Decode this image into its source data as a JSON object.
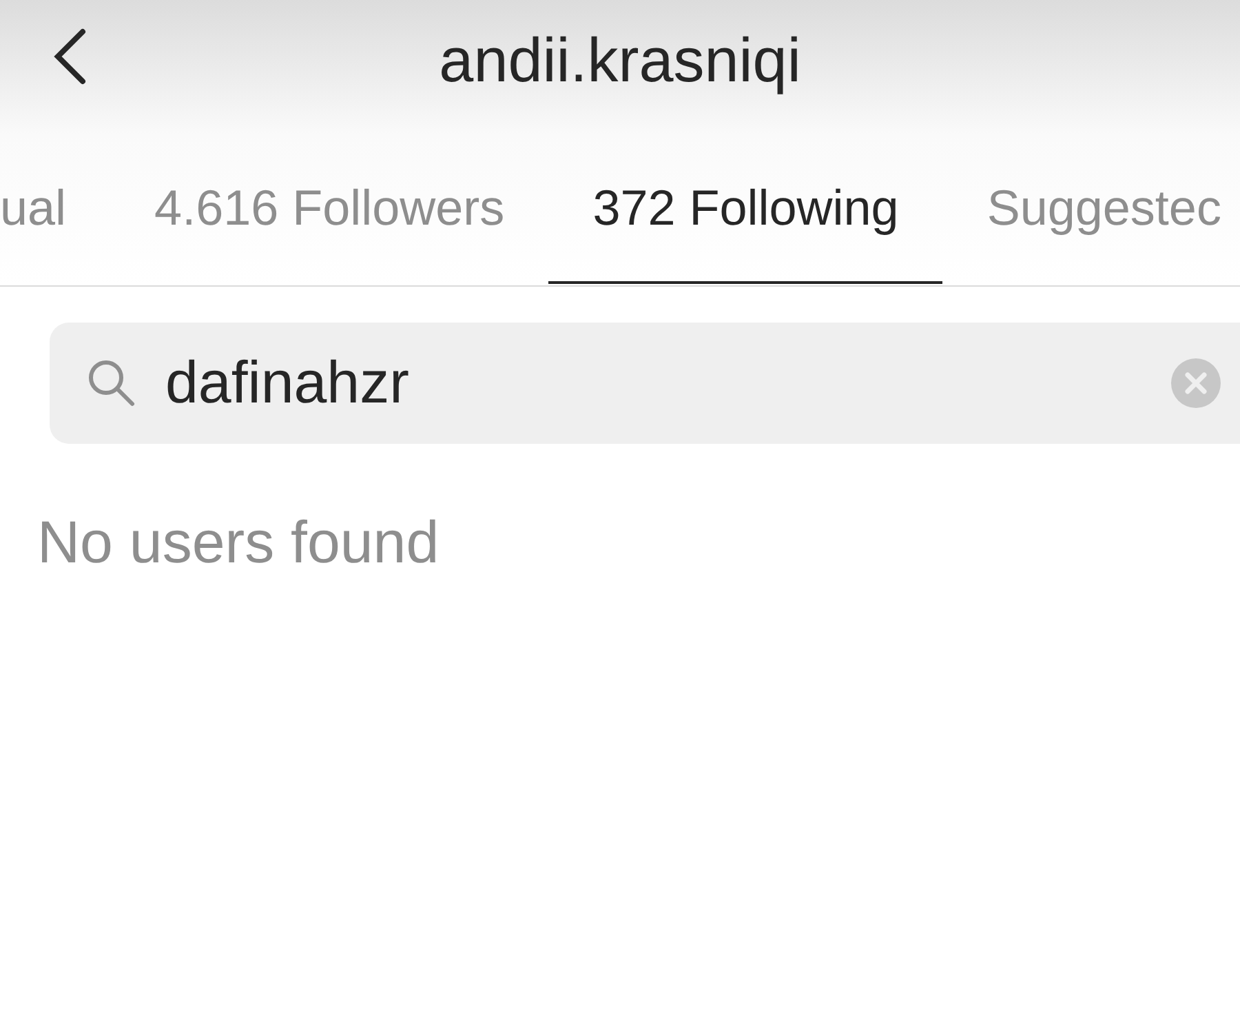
{
  "header": {
    "title": "andii.krasniqi"
  },
  "tabs": [
    {
      "label": "ual",
      "selected": false
    },
    {
      "label": "4.616 Followers",
      "selected": false
    },
    {
      "label": "372 Following",
      "selected": true
    },
    {
      "label": "Suggestec",
      "selected": false
    }
  ],
  "search": {
    "value": "dafinahzr"
  },
  "empty_message": "No users found"
}
